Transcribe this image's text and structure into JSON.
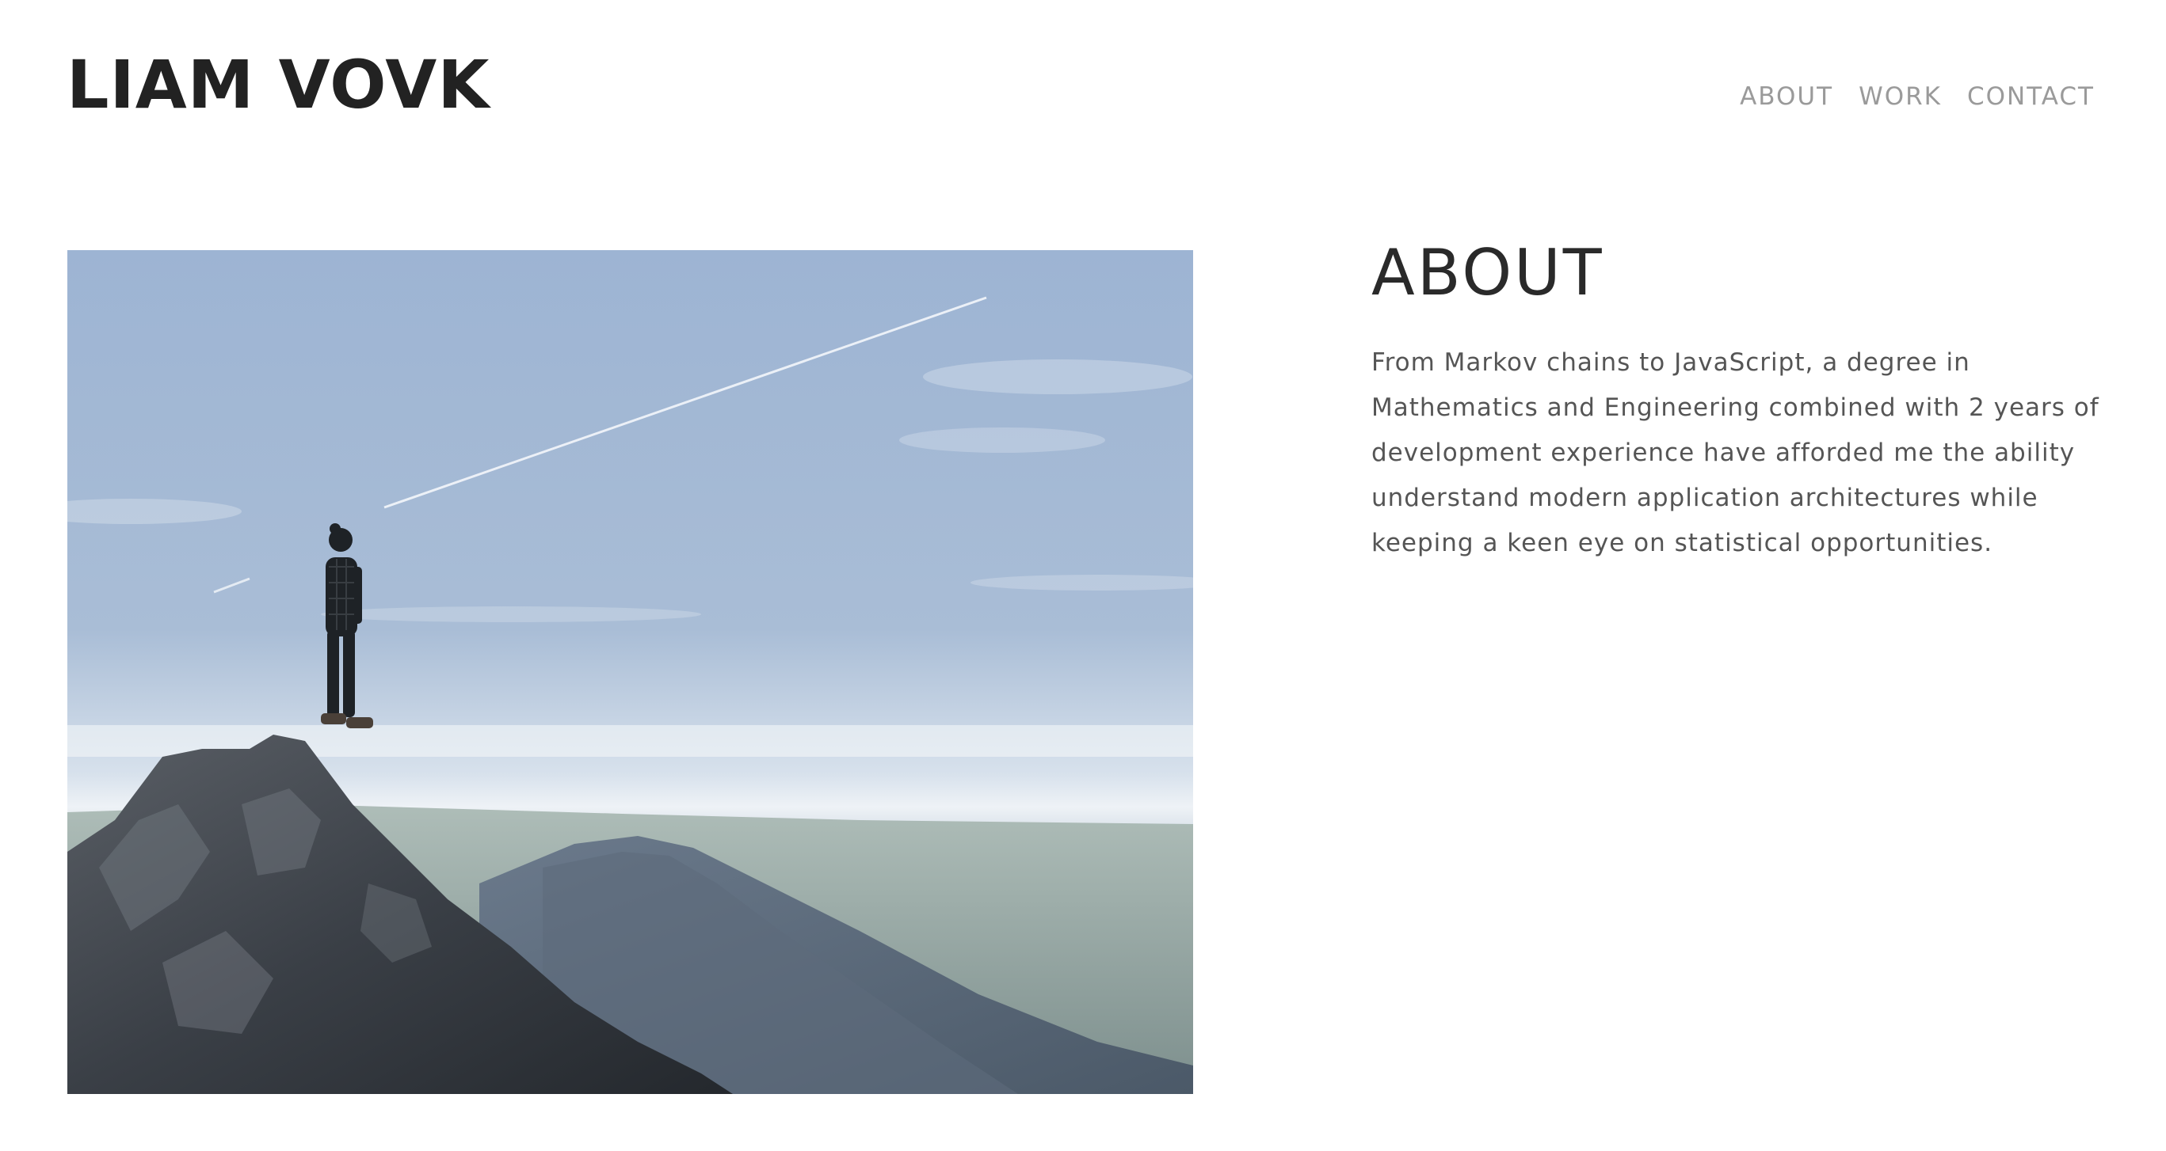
{
  "header": {
    "logo": "LIAM VOVK",
    "nav": [
      {
        "label": "ABOUT"
      },
      {
        "label": "WORK"
      },
      {
        "label": "CONTACT"
      }
    ]
  },
  "about": {
    "title": "ABOUT",
    "body": "From Markov chains to JavaScript, a degree in Mathematics and Engineering combined with 2 years of development experience have afforded me the ability understand modern application architectures while keeping a keen eye on statistical opportunities."
  },
  "photo": {
    "subject": "hiker-on-mountain-summit"
  },
  "colors": {
    "logo": "#222222",
    "nav": "#9a9a9a",
    "heading": "#2a2a2a",
    "body": "#555555",
    "sky": "#8fa9c8"
  }
}
